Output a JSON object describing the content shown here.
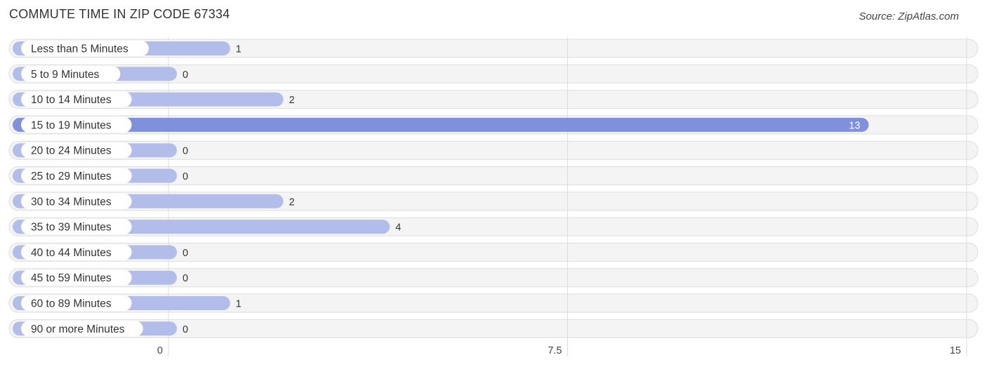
{
  "header": {
    "title": "COMMUTE TIME IN ZIP CODE 67334",
    "source": "Source: ZipAtlas.com"
  },
  "colors": {
    "bar_normal": "#b3bdea",
    "bar_highlight": "#7f90dc",
    "row_background": "#f4f4f4"
  },
  "chart_data": {
    "type": "bar",
    "orientation": "horizontal",
    "title": "COMMUTE TIME IN ZIP CODE 67334",
    "xlabel": "",
    "ylabel": "",
    "categories": [
      "Less than 5 Minutes",
      "5 to 9 Minutes",
      "10 to 14 Minutes",
      "15 to 19 Minutes",
      "20 to 24 Minutes",
      "25 to 29 Minutes",
      "30 to 34 Minutes",
      "35 to 39 Minutes",
      "40 to 44 Minutes",
      "45 to 59 Minutes",
      "60 to 89 Minutes",
      "90 or more Minutes"
    ],
    "values": [
      1,
      0,
      2,
      13,
      0,
      0,
      2,
      4,
      0,
      0,
      1,
      0
    ],
    "highlight_index": 3,
    "xlim": [
      0,
      15
    ],
    "x_ticks": [
      0,
      7.5,
      15
    ],
    "x_tick_labels": [
      "0",
      "7.5",
      "15"
    ],
    "grid": true,
    "legend": "none"
  }
}
